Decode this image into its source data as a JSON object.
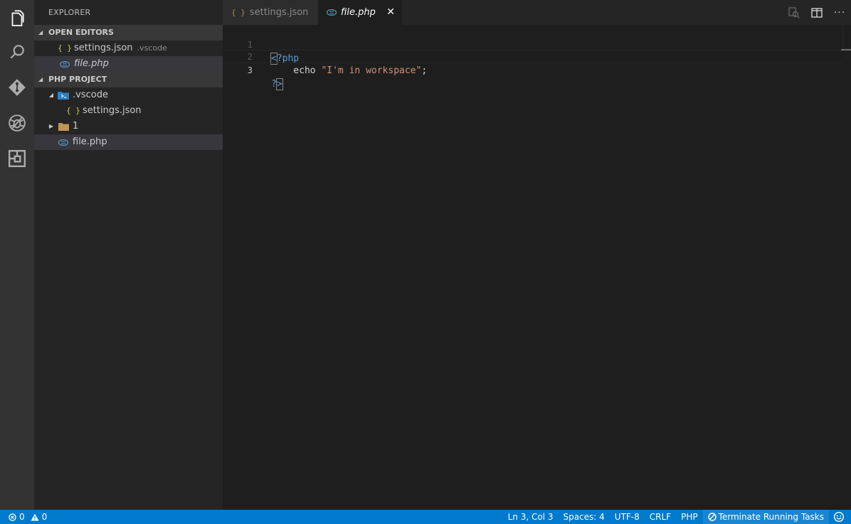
{
  "activity_bar": {
    "items": [
      {
        "name": "explorer-icon",
        "active": true
      },
      {
        "name": "search-icon",
        "active": false
      },
      {
        "name": "source-control-icon",
        "active": false
      },
      {
        "name": "debug-icon",
        "active": false
      },
      {
        "name": "extensions-icon",
        "active": false
      }
    ]
  },
  "sidebar": {
    "title": "EXPLORER",
    "open_editors": {
      "header": "OPEN EDITORS",
      "items": [
        {
          "label": "settings.json",
          "description": ".vscode",
          "icon": "json-icon"
        },
        {
          "label": "file.php",
          "description": "",
          "icon": "php-icon"
        }
      ]
    },
    "project": {
      "header": "PHP PROJECT",
      "tree": [
        {
          "label": ".vscode",
          "icon": "vscode-folder-icon",
          "expanded": true
        },
        {
          "label": "settings.json",
          "icon": "json-icon"
        },
        {
          "label": "1",
          "icon": "folder-icon",
          "expanded": false
        },
        {
          "label": "file.php",
          "icon": "php-icon"
        }
      ]
    }
  },
  "tabs": [
    {
      "label": "settings.json",
      "icon": "json-icon",
      "active": false
    },
    {
      "label": "file.php",
      "icon": "php-icon",
      "active": true,
      "close": "✕"
    }
  ],
  "editor": {
    "lines": [
      {
        "number": "1",
        "tokens": [
          {
            "text": "<",
            "cls": "kw bracket"
          },
          {
            "text": "?php",
            "cls": "kw"
          }
        ]
      },
      {
        "number": "2",
        "tokens": [
          {
            "text": "    echo ",
            "cls": "plain"
          },
          {
            "text": "\"I'm in workspace\"",
            "cls": "str"
          },
          {
            "text": ";",
            "cls": "plain"
          }
        ]
      },
      {
        "number": "3",
        "tokens": [
          {
            "text": "?",
            "cls": "kw"
          },
          {
            "text": ">",
            "cls": "kw bracket"
          }
        ]
      }
    ],
    "current_line": 3
  },
  "statusbar": {
    "errors": "0",
    "warnings": "0",
    "position": "Ln 3, Col 3",
    "spaces": "Spaces: 4",
    "encoding": "UTF-8",
    "eol": "CRLF",
    "language": "PHP",
    "task": "Terminate Running Tasks",
    "accent": "#007acc"
  }
}
